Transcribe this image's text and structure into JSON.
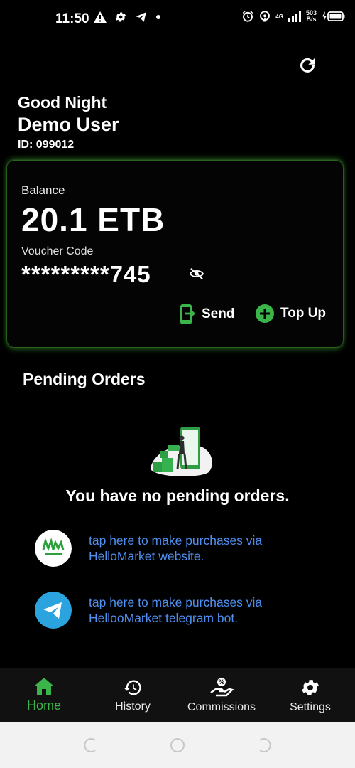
{
  "status_bar": {
    "time": "11:50",
    "network_type": "4G",
    "net_speed_value": "503",
    "net_speed_unit": "B/s",
    "icons": [
      "warning-icon",
      "gear-icon",
      "telegram-icon",
      "dot-icon",
      "alarm-icon",
      "hotspot-icon",
      "signal-icon",
      "battery-charging-icon"
    ]
  },
  "header": {
    "greeting": "Good Night",
    "username": "Demo User",
    "user_id": "ID: 099012"
  },
  "wallet": {
    "balance_label": "Balance",
    "balance_value": "20.1 ETB",
    "voucher_label": "Voucher Code",
    "voucher_value": "*********745",
    "send_label": "Send",
    "topup_label": "Top Up"
  },
  "pending": {
    "title": "Pending Orders",
    "empty_message": "You have no pending orders.",
    "links": [
      {
        "text": "tap here to make purchases via HelloMarket website.",
        "logo": "hellomarket-logo"
      },
      {
        "text": "tap here to make purchases via HellooMarket telegram bot.",
        "logo": "telegram-logo"
      }
    ]
  },
  "bottom_nav": [
    {
      "label": "Home",
      "icon": "home-icon",
      "active": true
    },
    {
      "label": "History",
      "icon": "history-icon",
      "active": false
    },
    {
      "label": "Commissions",
      "icon": "commissions-icon",
      "active": false
    },
    {
      "label": "Settings",
      "icon": "gear-icon",
      "active": false
    }
  ],
  "colors": {
    "accent_green": "#3bb54a",
    "link_blue": "#4e8ff0",
    "background": "#000000"
  }
}
